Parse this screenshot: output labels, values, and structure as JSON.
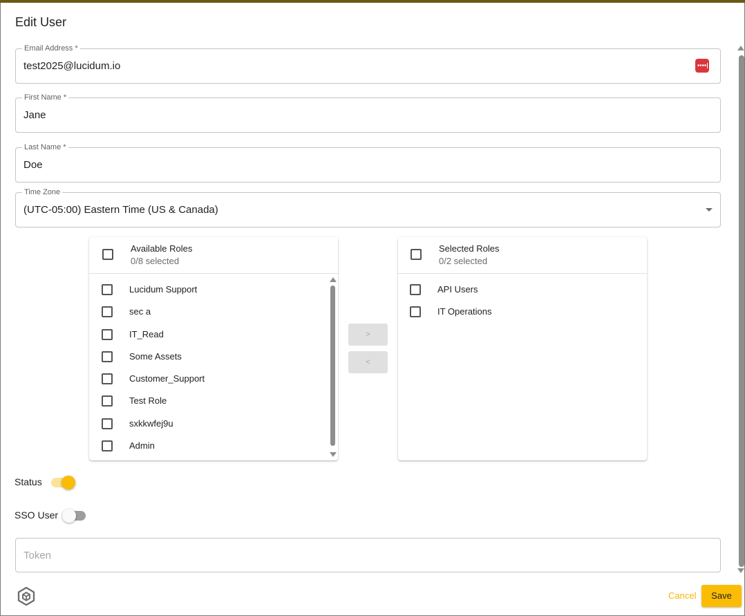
{
  "dialog": {
    "title": "Edit User"
  },
  "fields": {
    "email": {
      "label": "Email Address *",
      "value": "test2025@lucidum.io",
      "icon": "password-manager-icon"
    },
    "first_name": {
      "label": "First Name *",
      "value": "Jane"
    },
    "last_name": {
      "label": "Last Name *",
      "value": "Doe"
    },
    "time_zone": {
      "label": "Time Zone",
      "value": "(UTC-05:00) Eastern Time (US & Canada)"
    },
    "token": {
      "placeholder": "Token",
      "value": ""
    }
  },
  "roles": {
    "available": {
      "title": "Available Roles",
      "count_text": "0/8 selected",
      "items": [
        {
          "label": "Lucidum Support",
          "checked": false
        },
        {
          "label": "sec a",
          "checked": false
        },
        {
          "label": "IT_Read",
          "checked": false
        },
        {
          "label": "Some Assets",
          "checked": false
        },
        {
          "label": "Customer_Support",
          "checked": false
        },
        {
          "label": "Test Role",
          "checked": false
        },
        {
          "label": "sxkkwfej9u",
          "checked": false
        },
        {
          "label": "Admin",
          "checked": false
        }
      ]
    },
    "selected": {
      "title": "Selected Roles",
      "count_text": "0/2 selected",
      "items": [
        {
          "label": "API Users",
          "checked": false
        },
        {
          "label": "IT Operations",
          "checked": false
        }
      ]
    },
    "move_right_label": ">",
    "move_left_label": "<"
  },
  "toggles": {
    "status": {
      "label": "Status",
      "on": true
    },
    "sso_user": {
      "label": "SSO User",
      "on": false
    }
  },
  "actions": {
    "cancel_label": "Cancel",
    "save_label": "Save"
  },
  "colors": {
    "accent": "#fbbc05",
    "accent_text": "#f7b500",
    "track_on": "#fbe39a",
    "track_off": "#9e9e9e"
  }
}
